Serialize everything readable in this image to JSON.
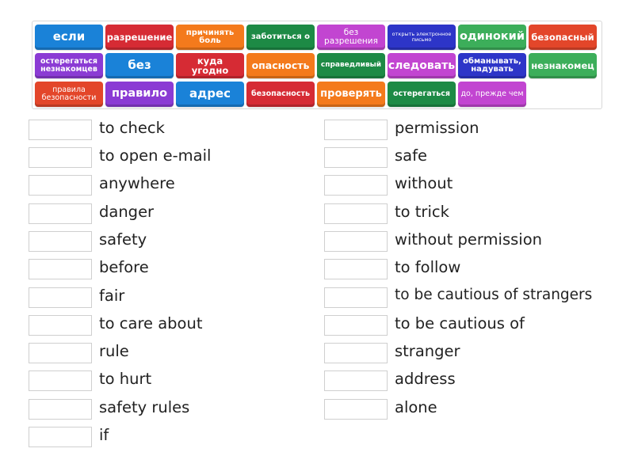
{
  "word_bank": {
    "tiles": [
      {
        "label": "если",
        "color": "#1a82d8"
      },
      {
        "label": "разрешение",
        "color": "#d62b34"
      },
      {
        "label": "причинять боль",
        "color": "#f47a1c"
      },
      {
        "label": "заботиться о",
        "color": "#1d8a45"
      },
      {
        "label": "без разрешения",
        "color": "#c245d1"
      },
      {
        "label": "открыть электронное письмо",
        "color": "#2d35c8"
      },
      {
        "label": "одинокий",
        "color": "#3cae5a"
      },
      {
        "label": "безопасный",
        "color": "#e3462a"
      },
      {
        "label": "остерегаться незнакомцев",
        "color": "#8b3bd4"
      },
      {
        "label": "без",
        "color": "#1a82d8"
      },
      {
        "label": "куда угодно",
        "color": "#d62b34"
      },
      {
        "label": "опасность",
        "color": "#f47a1c"
      },
      {
        "label": "справедливый",
        "color": "#1d8a45"
      },
      {
        "label": "следовать",
        "color": "#c245d1"
      },
      {
        "label": "обманывать, надувать",
        "color": "#2d35c8"
      },
      {
        "label": "незнакомец",
        "color": "#3cae5a"
      },
      {
        "label": "правила безопасности",
        "color": "#e3462a"
      },
      {
        "label": "правило",
        "color": "#8b3bd4"
      },
      {
        "label": "адрес",
        "color": "#1a82d8"
      },
      {
        "label": "безопасность",
        "color": "#d62b34"
      },
      {
        "label": "проверять",
        "color": "#f47a1c"
      },
      {
        "label": "остерегаться",
        "color": "#1d8a45"
      },
      {
        "label": "до, прежде чем",
        "color": "#c245d1"
      }
    ]
  },
  "left_column": [
    "to check",
    "to open e-mail",
    "anywhere",
    "danger",
    "safety",
    "before",
    "fair",
    "to care about",
    "rule",
    "to hurt",
    "safety rules",
    "if"
  ],
  "right_column": [
    "permission",
    "safe",
    "without",
    "to trick",
    "without permission",
    "to follow",
    "to be cautious of strangers",
    "to be cautious of",
    "stranger",
    "address",
    "alone"
  ]
}
